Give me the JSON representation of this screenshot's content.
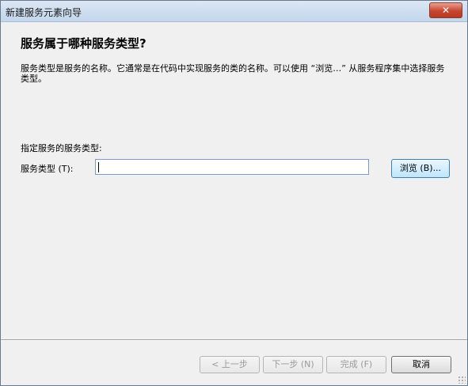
{
  "window": {
    "title": "新建服务元素向导",
    "close_glyph": "✕"
  },
  "header": {
    "heading": "服务属于哪种服务类型?",
    "description": "服务类型是服务的名称。它通常是在代码中实现服务的类的名称。可以使用 “浏览…” 从服务程序集中选择服务类型。"
  },
  "form": {
    "prompt": "指定服务的服务类型:",
    "service_type_label": "服务类型 (T):",
    "service_type_value": "",
    "browse_label": "浏览 (B)..."
  },
  "nav": {
    "back_label": "< 上一步",
    "next_label": "下一步 (N)",
    "finish_label": "完成 (F)",
    "cancel_label": "取消"
  }
}
